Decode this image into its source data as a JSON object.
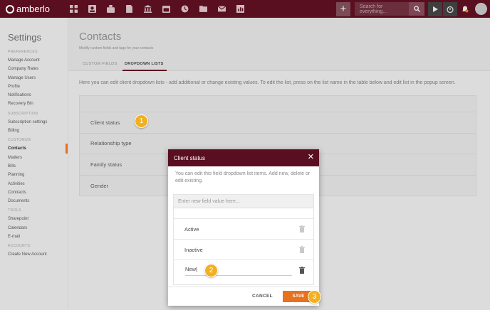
{
  "app": {
    "brand": "amberlo"
  },
  "topbar": {
    "nav_icons": [
      "dashboard-icon",
      "contacts-icon",
      "matters-icon",
      "documents-icon",
      "bank-icon",
      "calendar-icon",
      "history-icon",
      "folder-icon",
      "mail-icon",
      "reports-icon"
    ],
    "plus_label": "+",
    "search_placeholder": "Search for everything...",
    "right_icons": [
      "search-icon",
      "play-icon",
      "timer-icon",
      "bell-icon",
      "avatar"
    ]
  },
  "sidebar": {
    "title": "Settings",
    "groups": [
      {
        "label": "PREFERENCES",
        "items": [
          "Manage Account",
          "Company Rates",
          "Manage Users",
          "Profile",
          "Notifications",
          "Recovery Bin"
        ]
      },
      {
        "label": "SUBSCRIPTION",
        "items": [
          "Subscription settings",
          "Billing"
        ]
      },
      {
        "label": "CUSTOMIZE",
        "items": [
          "Contacts",
          "Matters",
          "Bills",
          "Planning",
          "Activities",
          "Contracts",
          "Documents"
        ]
      },
      {
        "label": "TOOLS",
        "items": [
          "Sharepoint",
          "Calendars",
          "E-mail"
        ]
      },
      {
        "label": "ACCOUNTS",
        "items": [
          "Create New Account"
        ]
      }
    ],
    "active_item": "Contacts"
  },
  "main": {
    "title": "Contacts",
    "subtitle": "Modify custom fields and tags for your contacts",
    "tabs": [
      {
        "label": "CUSTOM FIELDS"
      },
      {
        "label": "DROPDOWN LISTS"
      }
    ],
    "active_tab": "DROPDOWN LISTS",
    "description": "Here you can edit client dropdown lists - add additional or change existing values. To edit the list, press on the list name in the table below and edit list in the popup screen.",
    "lists": [
      "Client status",
      "Relationship type",
      "Family status",
      "Gender"
    ]
  },
  "modal": {
    "title": "Client status",
    "close_label": "✕",
    "description": "You can edit this field dropdown list items. Add new, delete or edit existing.",
    "new_value_placeholder": "Enter new field value here...",
    "items": [
      "Active",
      "Inactive"
    ],
    "editing_value": "New",
    "cancel_label": "CANCEL",
    "save_label": "SAVE"
  },
  "callouts": [
    "1",
    "2",
    "3"
  ],
  "colors": {
    "brand": "#5a0f21",
    "accent": "#e8711d",
    "callout": "#f2b020"
  }
}
